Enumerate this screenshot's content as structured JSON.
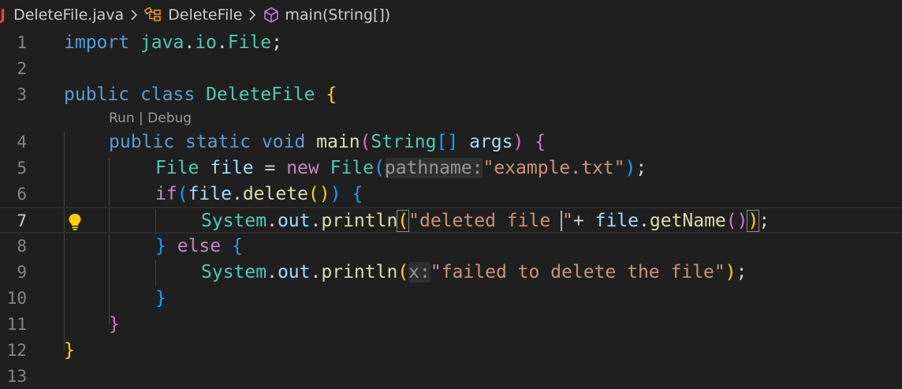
{
  "breadcrumb": {
    "file_icon": "J",
    "file": "DeleteFile.java",
    "class": "DeleteFile",
    "method": "main(String[])"
  },
  "codelens": {
    "run": "Run",
    "sep": " | ",
    "debug": "Debug"
  },
  "line_numbers": [
    "1",
    "2",
    "3",
    "4",
    "5",
    "6",
    "7",
    "8",
    "9",
    "10",
    "11",
    "12",
    "13"
  ],
  "code": {
    "l1": {
      "kw": "import",
      "pkg": "java",
      "dot1": ".",
      "pkg2": "io",
      "dot2": ".",
      "cls": "File",
      "semi": ";"
    },
    "l3": {
      "kw1": "public",
      "kw2": "class",
      "cls": "DeleteFile",
      "brace": "{"
    },
    "l4": {
      "kw1": "public",
      "kw2": "static",
      "kw3": "void",
      "fn": "main",
      "p1": "(",
      "type": "String",
      "arr": "[]",
      "arg": "args",
      "p2": ")",
      "brace": "{"
    },
    "l5": {
      "type": "File",
      "var": "file",
      "eq": " = ",
      "kw": "new",
      "ctor": "File",
      "p1": "(",
      "hint": "pathname:",
      "str": "\"example.txt\"",
      "p2": ")",
      "semi": ";"
    },
    "l6": {
      "kw": "if",
      "p1": "(",
      "var": "file",
      "dot": ".",
      "fn": "delete",
      "p2": "()",
      "p3": ")",
      "brace": "{"
    },
    "l7": {
      "cls": "System",
      "dot1": ".",
      "field": "out",
      "dot2": ".",
      "fn": "println",
      "p1": "(",
      "str1": "\"deleted file ",
      "str2": "\"",
      "plus": "+ ",
      "var": "file",
      "dot3": ".",
      "fn2": "getName",
      "p2": "()",
      "p3": ")",
      "semi": ";"
    },
    "l8": {
      "close": "}",
      "kw": "else",
      "brace": "{"
    },
    "l9": {
      "cls": "System",
      "dot1": ".",
      "field": "out",
      "dot2": ".",
      "fn": "println",
      "p1": "(",
      "hint": "x:",
      "str": "\"failed to delete the file\"",
      "p2": ")",
      "semi": ";"
    },
    "l10": {
      "brace": "}"
    },
    "l11": {
      "brace": "}"
    },
    "l12": {
      "brace": "}"
    }
  },
  "icons": [
    "java-file-icon",
    "chevron-right-icon",
    "class-icon",
    "method-cube-icon",
    "lightbulb-icon"
  ],
  "colors": {
    "background": "#1f1f1f",
    "keyword": "#569cd6",
    "type": "#4ec9b0",
    "string": "#ce9178",
    "function": "#dcdcaa",
    "variable": "#9cdcfe",
    "control": "#c586c0",
    "bracket_gold": "#ffd700"
  }
}
